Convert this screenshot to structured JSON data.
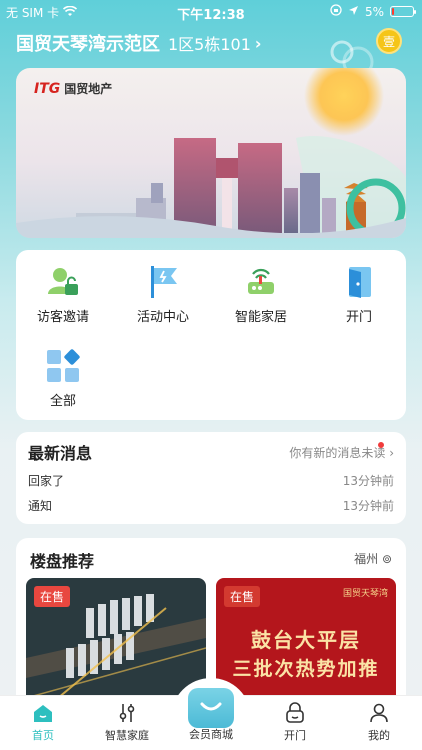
{
  "status_bar": {
    "carrier": "无 SIM 卡",
    "time": "下午12:38",
    "battery": "5%",
    "battery_level": 0.05
  },
  "header": {
    "community": "国贸天琴湾示范区",
    "unit": "1区5栋101",
    "chevron": "›",
    "coin_label": "壹"
  },
  "banner": {
    "brand_mark": "ITG",
    "brand_name": "国贸地产"
  },
  "services": [
    {
      "label": "访客邀请",
      "icon": "visitor-invite-icon"
    },
    {
      "label": "活动中心",
      "icon": "activity-flag-icon"
    },
    {
      "label": "智能家居",
      "icon": "smart-home-router-icon"
    },
    {
      "label": "开门",
      "icon": "open-door-icon"
    },
    {
      "label": "全部",
      "icon": "all-apps-grid-icon"
    }
  ],
  "news": {
    "title": "最新消息",
    "hint": "你有新的消息未读",
    "items": [
      {
        "text": "回家了",
        "time": "13分钟前"
      },
      {
        "text": "通知",
        "time": "13分钟前"
      }
    ]
  },
  "recommend": {
    "title": "楼盘推荐",
    "city": "福州",
    "properties": [
      {
        "tag": "在售"
      },
      {
        "tag": "在售",
        "headline": "鼓台大平层",
        "subline": "三批次热势加推",
        "logo": "国贸天琴湾"
      }
    ]
  },
  "tabbar": [
    {
      "label": "首页",
      "icon": "home-icon",
      "active": true
    },
    {
      "label": "智慧家庭",
      "icon": "sliders-icon",
      "active": false
    },
    {
      "label": "会员商城",
      "icon": "shopping-bag-icon",
      "active": false
    },
    {
      "label": "开门",
      "icon": "lock-icon",
      "active": false
    },
    {
      "label": "我的",
      "icon": "person-icon",
      "active": false
    }
  ],
  "colors": {
    "accent": "#2dbfbf",
    "sale_tag": "#e8473f",
    "coin": "#f5c518"
  }
}
